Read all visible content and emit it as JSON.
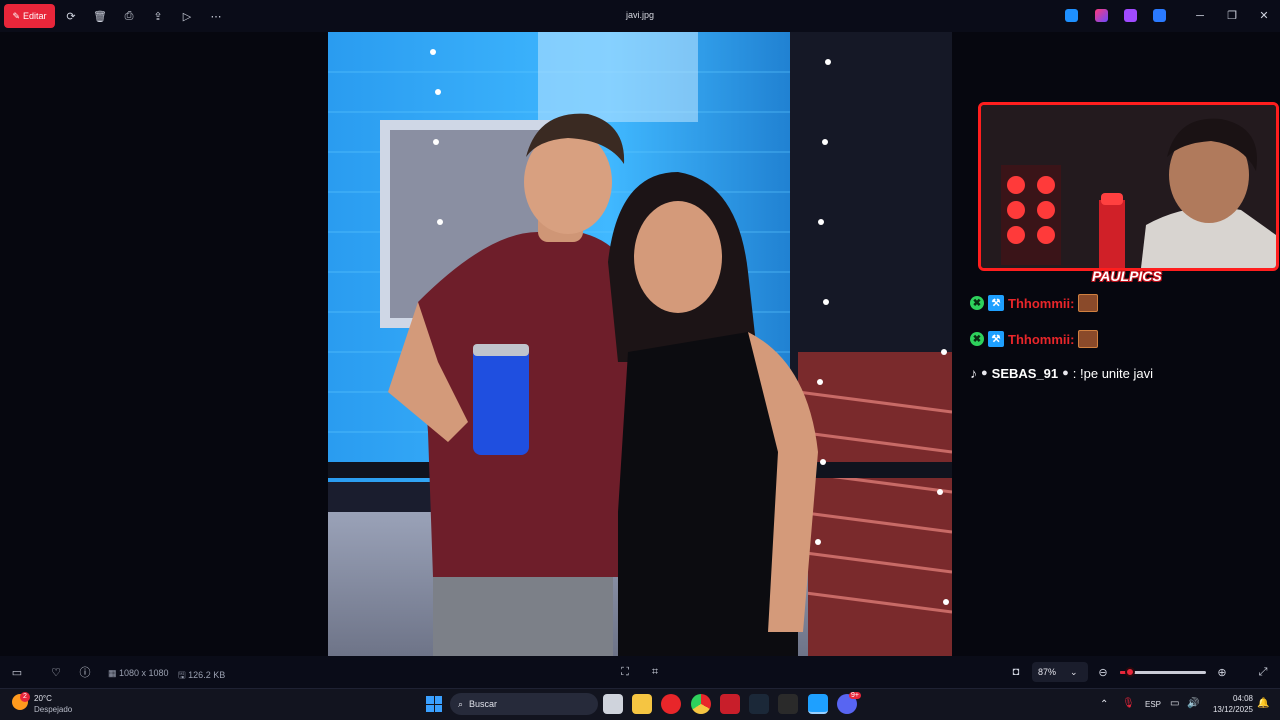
{
  "titlebar": {
    "edit_label": "Editar",
    "filename": "javi.jpg",
    "icons": [
      "rotate-icon",
      "delete-icon",
      "print-icon",
      "share-icon",
      "slideshow-icon",
      "more-icon"
    ],
    "window_controls": [
      "minimize-icon",
      "maximize-icon",
      "close-icon"
    ]
  },
  "overlay": {
    "brand": "PAULPICS",
    "chat": [
      {
        "user": "Thhommii:",
        "user_color": "#e8262a",
        "message": ""
      },
      {
        "user": "Thhommii:",
        "user_color": "#e8262a",
        "message": ""
      },
      {
        "user": "SEBAS_91",
        "user_color": "#ffffff",
        "message": ": !pe unite javi"
      }
    ]
  },
  "bottombar": {
    "dimensions": "1080 x 1080",
    "filesize": "126.2 KB",
    "zoom": "87%",
    "zoom_level": 0.12
  },
  "taskbar": {
    "weather_temp": "20°C",
    "weather_desc": "Despejado",
    "weather_badge": "2",
    "search_placeholder": "Buscar",
    "language": "ESP",
    "time": "04:08",
    "date": "13/12/2025",
    "discord_badge": "9+"
  },
  "colors": {
    "accent": "#e8263a",
    "frame": "#ff1e1e"
  }
}
